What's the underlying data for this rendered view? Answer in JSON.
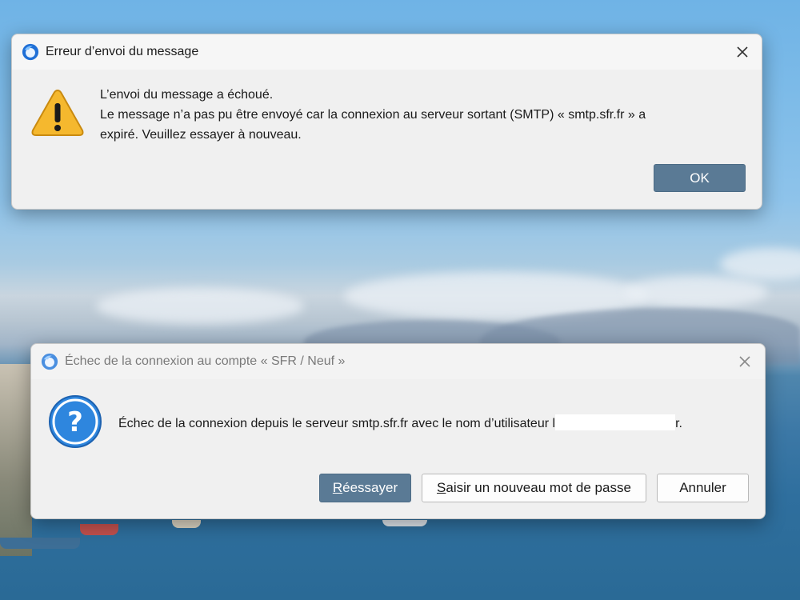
{
  "error_dialog": {
    "title": "Erreur d’envoi du message",
    "heading": "L’envoi du message a échoué.",
    "message_line1": "Le message n’a pas pu être envoyé car la connexion au serveur sortant (SMTP) « smtp.sfr.fr » a",
    "message_line2": "expiré. Veuillez essayer à nouveau.",
    "ok_label": "OK",
    "warning_icon": "warning-icon"
  },
  "login_dialog": {
    "title": "Échec de la connexion au compte « SFR / Neuf »",
    "message_prefix": "Échec de la connexion depuis le serveur smtp.sfr.fr avec le nom d’utilisateur ",
    "username_prefix": "l",
    "username_suffix": "r.",
    "retry_mnemonic": "R",
    "retry_rest": "éessayer",
    "new_password_mnemonic": "S",
    "new_password_rest": "aisir un nouveau mot de passe",
    "cancel_label": "Annuler",
    "question_icon": "question-icon"
  },
  "colors": {
    "primary_button": "#5a7a95",
    "dialog_background": "#f0f0f0",
    "warning_yellow": "#f5b82e",
    "question_blue": "#2e86de"
  }
}
